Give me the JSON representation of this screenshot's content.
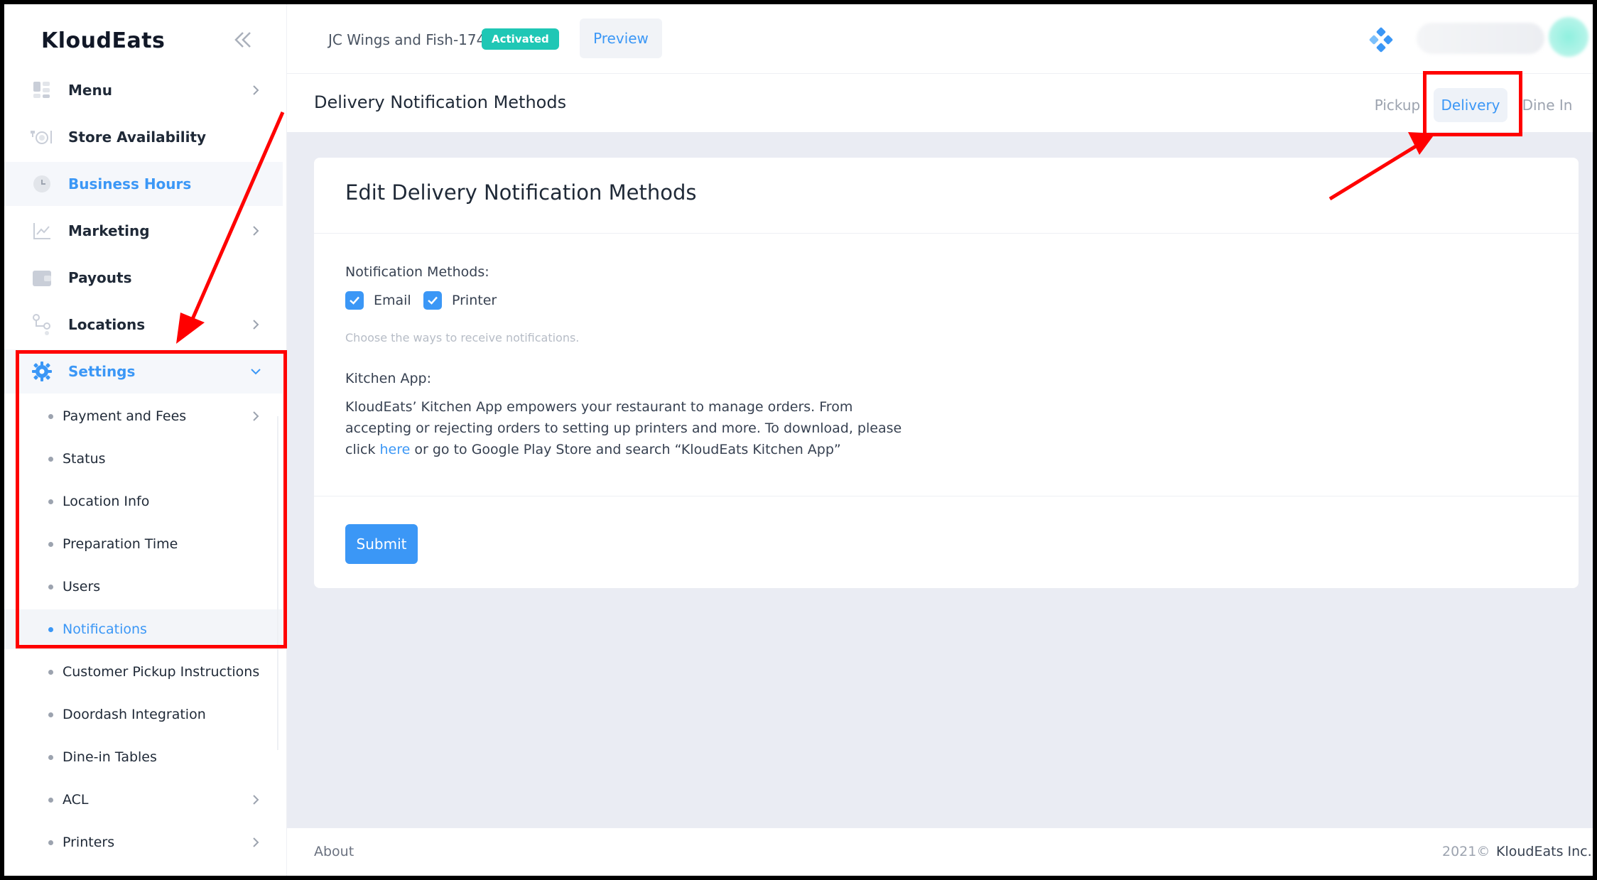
{
  "sidebar": {
    "brand": "KloudEats",
    "items": [
      {
        "label": "Menu",
        "icon": "menu-grid-icon"
      },
      {
        "label": "Store Availability",
        "icon": "dining-icon"
      },
      {
        "label": "Business Hours",
        "icon": "clock-icon"
      },
      {
        "label": "Marketing",
        "icon": "chart-line-icon"
      },
      {
        "label": "Payouts",
        "icon": "wallet-icon"
      },
      {
        "label": "Locations",
        "icon": "location-nodes-icon"
      },
      {
        "label": "Settings",
        "icon": "gear-icon"
      }
    ],
    "settings_sub": [
      {
        "label": "Payment and Fees"
      },
      {
        "label": "Status"
      },
      {
        "label": "Location Info"
      },
      {
        "label": "Preparation Time"
      },
      {
        "label": "Users"
      },
      {
        "label": "Notifications"
      },
      {
        "label": "Customer Pickup Instructions"
      },
      {
        "label": "Doordash Integration"
      },
      {
        "label": "Dine-in Tables"
      },
      {
        "label": "ACL"
      },
      {
        "label": "Printers"
      }
    ]
  },
  "topbar": {
    "store_name": "JC Wings and Fish-174",
    "status_badge": "Activated",
    "preview_label": "Preview"
  },
  "subheader": {
    "title": "Delivery Notification Methods",
    "tabs": [
      {
        "label": "Pickup"
      },
      {
        "label": "Delivery"
      },
      {
        "label": "Dine In"
      }
    ]
  },
  "card": {
    "title": "Edit Delivery Notification Methods",
    "methods_label": "Notification Methods:",
    "email_label": "Email",
    "email_checked": true,
    "printer_label": "Printer",
    "printer_checked": true,
    "hint": "Choose the ways to receive notifications.",
    "kitchen_label": "Kitchen App:",
    "kitchen_text_1": "KloudEats’ Kitchen App empowers your restaurant to manage orders. From accepting or rejecting orders to setting up printers and more. To download, please click",
    "kitchen_link": "here",
    "kitchen_text_2": "or go to Google Play Store and search “KloudEats Kitchen App”",
    "submit_label": "Submit"
  },
  "footer": {
    "about": "About",
    "year": "2021©",
    "company": "KloudEats Inc."
  },
  "colors": {
    "accent": "#3b97f6",
    "badge": "#1fc7b5",
    "annotation": "#ff0000"
  }
}
